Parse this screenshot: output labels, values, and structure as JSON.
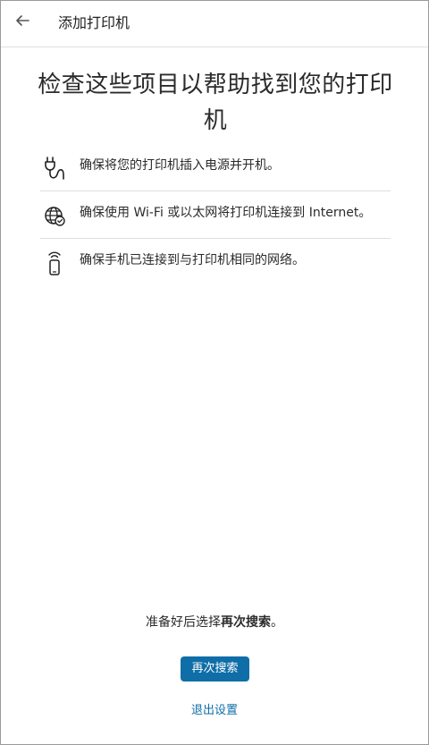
{
  "app_bar": {
    "title": "添加打印机",
    "back_icon": "arrow-left-icon"
  },
  "main": {
    "heading": "检查这些项目以帮助找到您的打印机",
    "checklist": [
      {
        "icon": "power-plug-icon",
        "text": "确保将您的打印机插入电源并开机。"
      },
      {
        "icon": "globe-network-icon",
        "text": "确保使用 Wi-Fi 或以太网将打印机连接到 Internet。"
      },
      {
        "icon": "phone-wifi-icon",
        "text": "确保手机已连接到与打印机相同的网络。"
      }
    ]
  },
  "footer": {
    "prompt_prefix": "准备好后选择",
    "prompt_bold": "再次搜索",
    "prompt_suffix": "。",
    "search_again_label": "再次搜索",
    "exit_label": "退出设置"
  },
  "colors": {
    "accent": "#0f6ea8",
    "text": "#2b2b2b",
    "divider": "#dedede"
  }
}
